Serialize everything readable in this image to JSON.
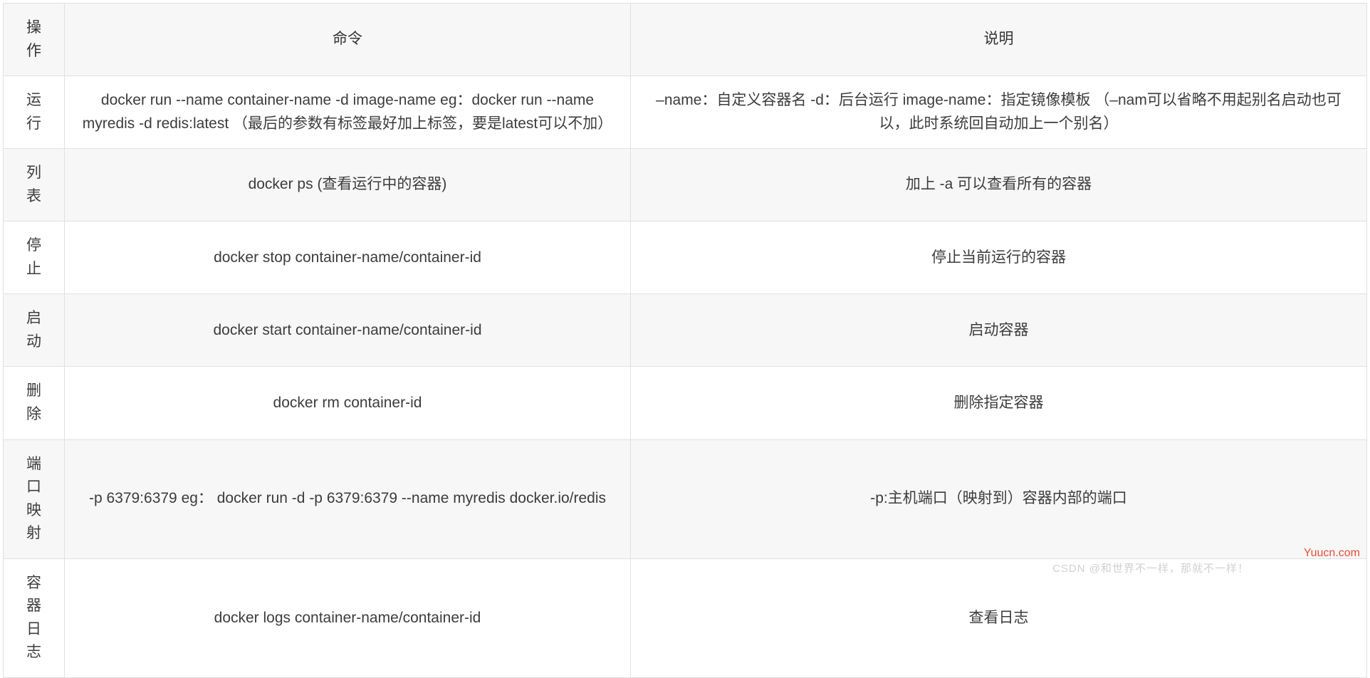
{
  "table": {
    "headers": {
      "operation": "操作",
      "command": "命令",
      "description": "说明"
    },
    "rows": [
      {
        "operation": "运行",
        "command": "docker run --name container-name -d image-name eg：docker run --name myredis -d redis:latest （最后的参数有标签最好加上标签，要是latest可以不加）",
        "description": "–name：自定义容器名 -d：后台运行 image-name：指定镜像模板 （–nam可以省略不用起别名启动也可以，此时系统回自动加上一个别名）"
      },
      {
        "operation": "列表",
        "command": "docker ps (查看运行中的容器)",
        "description": "加上 -a 可以查看所有的容器"
      },
      {
        "operation": "停止",
        "command": "docker stop container-name/container-id",
        "description": "停止当前运行的容器"
      },
      {
        "operation": "启动",
        "command": "docker start container-name/container-id",
        "description": "启动容器"
      },
      {
        "operation": "删除",
        "command": "docker rm container-id",
        "description": "删除指定容器"
      },
      {
        "operation": "端口映射",
        "command": "-p 6379:6379 eg： docker run -d -p 6379:6379 --name myredis docker.io/redis",
        "description": "-p:主机端口（映射到）容器内部的端口"
      },
      {
        "operation": "容器日志",
        "command": "docker logs container-name/container-id",
        "description": "查看日志"
      }
    ]
  },
  "watermarks": {
    "csdn": "CSDN @和世界不一样，那就不一样！",
    "yuucn": "Yuucn.com"
  }
}
